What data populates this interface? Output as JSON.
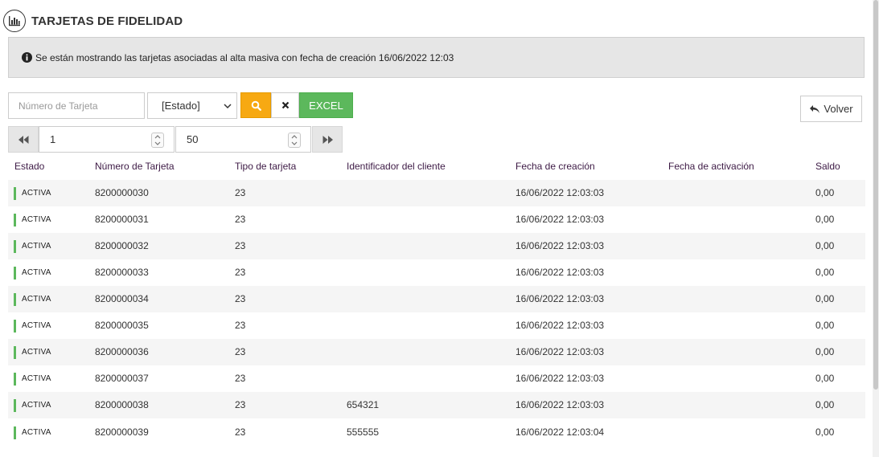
{
  "header": {
    "title": "TARJETAS DE FIDELIDAD",
    "icon": "bar-chart-icon"
  },
  "info": {
    "text": "Se están mostrando las tarjetas asociadas al alta masiva con fecha de creación 16/06/2022 12:03",
    "icon": "info-icon"
  },
  "filters": {
    "card_number_placeholder": "Número de Tarjeta",
    "estado_value": "[Estado]",
    "search_icon": "search-icon",
    "clear_icon": "close-icon",
    "excel_label": "EXCEL"
  },
  "back_button": {
    "label": "Volver",
    "icon": "undo-arrow-icon"
  },
  "pager": {
    "page": "1",
    "page_size": "50"
  },
  "table": {
    "columns": [
      "Estado",
      "Número de Tarjeta",
      "Tipo de tarjeta",
      "Identificador del cliente",
      "Fecha de creación",
      "Fecha de activación",
      "Saldo"
    ],
    "rows": [
      {
        "estado": "ACTIVA",
        "numero": "8200000030",
        "tipo": "23",
        "cliente": "",
        "creacion": "16/06/2022 12:03:03",
        "activacion": "",
        "saldo": "0,00"
      },
      {
        "estado": "ACTIVA",
        "numero": "8200000031",
        "tipo": "23",
        "cliente": "",
        "creacion": "16/06/2022 12:03:03",
        "activacion": "",
        "saldo": "0,00"
      },
      {
        "estado": "ACTIVA",
        "numero": "8200000032",
        "tipo": "23",
        "cliente": "",
        "creacion": "16/06/2022 12:03:03",
        "activacion": "",
        "saldo": "0,00"
      },
      {
        "estado": "ACTIVA",
        "numero": "8200000033",
        "tipo": "23",
        "cliente": "",
        "creacion": "16/06/2022 12:03:03",
        "activacion": "",
        "saldo": "0,00"
      },
      {
        "estado": "ACTIVA",
        "numero": "8200000034",
        "tipo": "23",
        "cliente": "",
        "creacion": "16/06/2022 12:03:03",
        "activacion": "",
        "saldo": "0,00"
      },
      {
        "estado": "ACTIVA",
        "numero": "8200000035",
        "tipo": "23",
        "cliente": "",
        "creacion": "16/06/2022 12:03:03",
        "activacion": "",
        "saldo": "0,00"
      },
      {
        "estado": "ACTIVA",
        "numero": "8200000036",
        "tipo": "23",
        "cliente": "",
        "creacion": "16/06/2022 12:03:03",
        "activacion": "",
        "saldo": "0,00"
      },
      {
        "estado": "ACTIVA",
        "numero": "8200000037",
        "tipo": "23",
        "cliente": "",
        "creacion": "16/06/2022 12:03:03",
        "activacion": "",
        "saldo": "0,00"
      },
      {
        "estado": "ACTIVA",
        "numero": "8200000038",
        "tipo": "23",
        "cliente": "654321",
        "creacion": "16/06/2022 12:03:03",
        "activacion": "",
        "saldo": "0,00"
      },
      {
        "estado": "ACTIVA",
        "numero": "8200000039",
        "tipo": "23",
        "cliente": "555555",
        "creacion": "16/06/2022 12:03:04",
        "activacion": "",
        "saldo": "0,00"
      }
    ]
  },
  "colors": {
    "accent_search": "#f7a912",
    "excel_green": "#5cb85c",
    "status_active": "#5cb85c",
    "header_text": "#3d1a45",
    "info_bg": "#e6e6e6"
  }
}
